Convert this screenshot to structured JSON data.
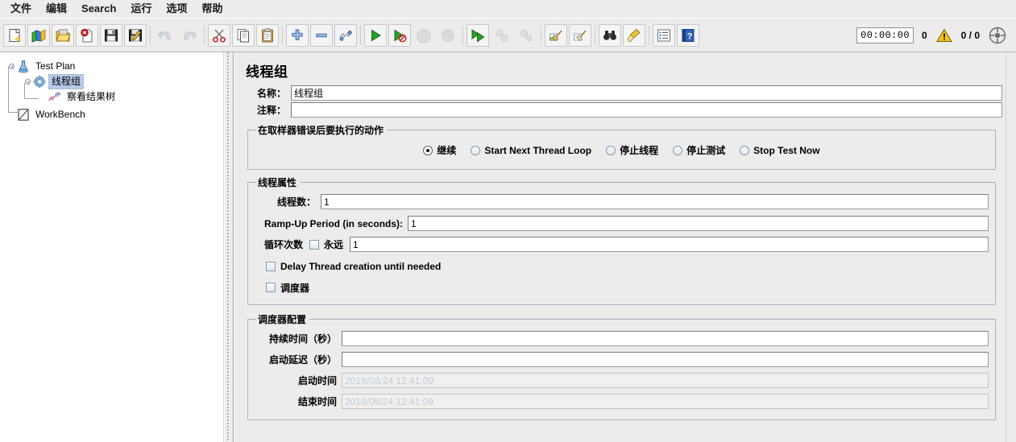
{
  "window": {
    "title": "线程组"
  },
  "menubar": {
    "items": [
      {
        "label": "文件",
        "name": "menu-file"
      },
      {
        "label": "编辑",
        "name": "menu-edit"
      },
      {
        "label": "Search",
        "name": "menu-search"
      },
      {
        "label": "运行",
        "name": "menu-run"
      },
      {
        "label": "选项",
        "name": "menu-options"
      },
      {
        "label": "帮助",
        "name": "menu-help"
      }
    ]
  },
  "toolbar": {
    "buttons": [
      {
        "icon": "new-document-icon",
        "name": "toolbar-new",
        "enabled": true
      },
      {
        "icon": "templates-icon",
        "name": "toolbar-templates",
        "enabled": true
      },
      {
        "icon": "open-folder-icon",
        "name": "toolbar-open",
        "enabled": true
      },
      {
        "icon": "close-document-icon",
        "name": "toolbar-close",
        "enabled": true
      },
      {
        "icon": "save-floppy-icon",
        "name": "toolbar-save",
        "enabled": true
      },
      {
        "icon": "save-as-icon",
        "name": "toolbar-save-as",
        "enabled": true
      },
      {
        "icon": "undo-arrow-icon",
        "name": "toolbar-undo",
        "enabled": false
      },
      {
        "icon": "redo-arrow-icon",
        "name": "toolbar-redo",
        "enabled": false
      },
      {
        "icon": "scissors-cut-icon",
        "name": "toolbar-cut",
        "enabled": true
      },
      {
        "icon": "copy-pages-icon",
        "name": "toolbar-copy",
        "enabled": true
      },
      {
        "icon": "clipboard-paste-icon",
        "name": "toolbar-paste",
        "enabled": true
      },
      {
        "icon": "expand-plus-icon",
        "name": "toolbar-expand-all",
        "enabled": true
      },
      {
        "icon": "collapse-minus-icon",
        "name": "toolbar-collapse-all",
        "enabled": true
      },
      {
        "icon": "toggle-switch-icon",
        "name": "toolbar-toggle",
        "enabled": true
      },
      {
        "icon": "start-play-icon",
        "name": "toolbar-start",
        "enabled": true
      },
      {
        "icon": "start-no-pauses-icon",
        "name": "toolbar-start-no-pauses",
        "enabled": true
      },
      {
        "icon": "stop-octagon-icon",
        "name": "toolbar-stop",
        "enabled": false
      },
      {
        "icon": "shutdown-circle-icon",
        "name": "toolbar-shutdown",
        "enabled": false
      },
      {
        "icon": "remote-start-all-icon",
        "name": "toolbar-remote-start-all",
        "enabled": true
      },
      {
        "icon": "remote-stop-all-icon",
        "name": "toolbar-remote-stop-all",
        "enabled": false
      },
      {
        "icon": "remote-shutdown-all-icon",
        "name": "toolbar-remote-shutdown-all",
        "enabled": false
      },
      {
        "icon": "clear-broom-icon",
        "name": "toolbar-clear",
        "enabled": true
      },
      {
        "icon": "clear-all-broom-icon",
        "name": "toolbar-clear-all",
        "enabled": true
      },
      {
        "icon": "binoculars-search-icon",
        "name": "toolbar-search",
        "enabled": true
      },
      {
        "icon": "reset-search-broom-icon",
        "name": "toolbar-reset-search",
        "enabled": true
      },
      {
        "icon": "function-helper-list-icon",
        "name": "toolbar-function-helper",
        "enabled": true
      },
      {
        "icon": "help-book-icon",
        "name": "toolbar-help",
        "enabled": true
      }
    ],
    "status": {
      "elapsed": "00:00:00",
      "warning_count": "0",
      "warning_icon": "warning-triangle-icon",
      "threads_running": "0 / 0",
      "connect_icon": "connection-status-icon"
    }
  },
  "tree": {
    "nodes": [
      {
        "label": "Test Plan",
        "icon": "test-plan-icon",
        "selected": false,
        "depth": 0
      },
      {
        "label": "线程组",
        "icon": "thread-group-gear-icon",
        "selected": true,
        "depth": 1
      },
      {
        "label": "察看结果树",
        "icon": "view-results-tree-icon",
        "selected": false,
        "depth": 2
      },
      {
        "label": "WorkBench",
        "icon": "workbench-icon",
        "selected": false,
        "depth": 0
      }
    ]
  },
  "main": {
    "title": "线程组",
    "name_label": "名称：",
    "name_value": "线程组",
    "comment_label": "注释：",
    "comment_value": "",
    "error_action": {
      "legend": "在取样器错误后要执行的动作",
      "options": [
        {
          "label": "继续",
          "selected": true,
          "name": "radio-continue"
        },
        {
          "label": "Start Next Thread Loop",
          "selected": false,
          "name": "radio-start-next-thread-loop"
        },
        {
          "label": "停止线程",
          "selected": false,
          "name": "radio-stop-thread"
        },
        {
          "label": "停止测试",
          "selected": false,
          "name": "radio-stop-test"
        },
        {
          "label": "Stop Test Now",
          "selected": false,
          "name": "radio-stop-test-now"
        }
      ]
    },
    "thread_properties": {
      "legend": "线程属性",
      "num_threads_label": "线程数：",
      "num_threads_value": "1",
      "ramp_up_label": "Ramp-Up Period (in seconds):",
      "ramp_up_value": "1",
      "loop_count_label": "循环次数",
      "forever_label": "永远",
      "forever_checked": false,
      "loop_count_value": "1",
      "delay_thread_label": "Delay Thread creation until needed",
      "delay_thread_checked": false,
      "scheduler_label": "调度器",
      "scheduler_checked": false
    },
    "scheduler_config": {
      "legend": "调度器配置",
      "duration_label": "持续时间（秒）",
      "duration_value": "",
      "startup_delay_label": "启动延迟（秒）",
      "startup_delay_value": "",
      "start_time_label": "启动时间",
      "start_time_value": "2018/08/24 12:41:09",
      "end_time_label": "结束时间",
      "end_time_value": "2018/08/24 12:41:09"
    }
  },
  "colors": {
    "background": "#ececec",
    "selection": "#b5cae8",
    "field_background": "#ffffff",
    "readonly_text": "#bcc5ce",
    "border": "#b0b4bb"
  }
}
